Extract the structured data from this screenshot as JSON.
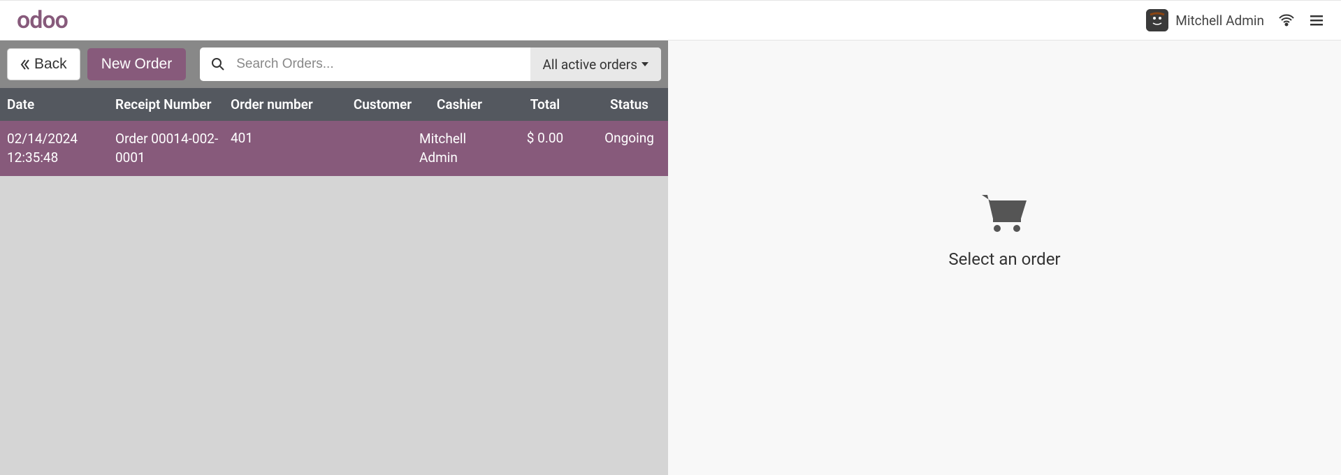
{
  "header": {
    "logo": "odoo",
    "user_name": "Mitchell Admin"
  },
  "toolbar": {
    "back_label": "Back",
    "new_order_label": "New Order",
    "search_placeholder": "Search Orders...",
    "filter_label": "All active orders"
  },
  "table": {
    "headers": {
      "date": "Date",
      "receipt": "Receipt Number",
      "order": "Order number",
      "customer": "Customer",
      "cashier": "Cashier",
      "total": "Total",
      "status": "Status"
    },
    "rows": [
      {
        "date": "02/14/2024 12:35:48",
        "receipt": "Order 00014-002-0001",
        "order": "401",
        "customer": "",
        "cashier": "Mitchell Admin",
        "total": "$ 0.00",
        "status": "Ongoing"
      }
    ]
  },
  "detail": {
    "empty_text": "Select an order"
  }
}
